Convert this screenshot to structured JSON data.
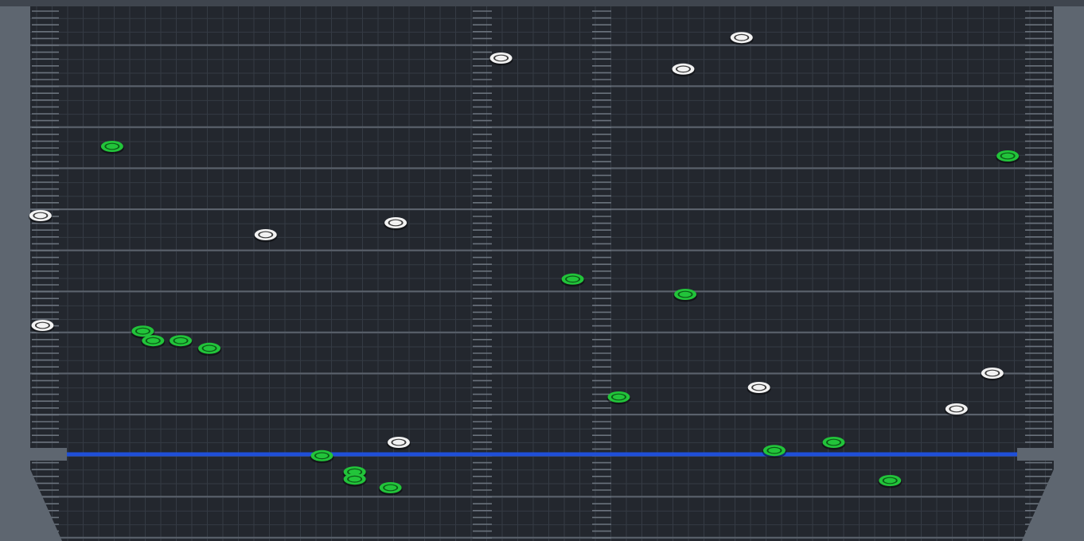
{
  "game": {
    "colors": {
      "background": "#23272e",
      "grid_line": "#353b44",
      "lane_line": "#5b626c",
      "frame": "#5e6670",
      "frame_dark": "#3f454e",
      "ruler_tick": "#6a727c",
      "judgment_line": "#1f4fd8",
      "note_green": "#22c43a",
      "note_green_dark": "#0c5a18",
      "note_white": "#f2f2f2",
      "note_white_dark": "#3a3a3a"
    },
    "icon_names": {
      "green_note": "green-note-icon",
      "white_note": "white-note-icon"
    },
    "notes": [
      {
        "type": "white",
        "lane": 0.01,
        "time": 0.5
      },
      {
        "type": "white",
        "lane": 0.012,
        "time": 0.27
      },
      {
        "type": "green",
        "lane": 0.08,
        "time": 0.645
      },
      {
        "type": "green",
        "lane": 0.11,
        "time": 0.258
      },
      {
        "type": "green",
        "lane": 0.12,
        "time": 0.238
      },
      {
        "type": "green",
        "lane": 0.147,
        "time": 0.238
      },
      {
        "type": "green",
        "lane": 0.175,
        "time": 0.222
      },
      {
        "type": "white",
        "lane": 0.23,
        "time": 0.46
      },
      {
        "type": "green",
        "lane": 0.285,
        "time": -0.003
      },
      {
        "type": "green",
        "lane": 0.317,
        "time": -0.037
      },
      {
        "type": "green",
        "lane": 0.317,
        "time": -0.052
      },
      {
        "type": "green",
        "lane": 0.352,
        "time": -0.07
      },
      {
        "type": "white",
        "lane": 0.357,
        "time": 0.485
      },
      {
        "type": "white",
        "lane": 0.36,
        "time": 0.025
      },
      {
        "type": "white",
        "lane": 0.46,
        "time": 0.83
      },
      {
        "type": "green",
        "lane": 0.53,
        "time": 0.367
      },
      {
        "type": "green",
        "lane": 0.575,
        "time": 0.12
      },
      {
        "type": "white",
        "lane": 0.638,
        "time": 0.807
      },
      {
        "type": "green",
        "lane": 0.64,
        "time": 0.335
      },
      {
        "type": "white",
        "lane": 0.695,
        "time": 0.873
      },
      {
        "type": "white",
        "lane": 0.712,
        "time": 0.14
      },
      {
        "type": "green",
        "lane": 0.727,
        "time": 0.008
      },
      {
        "type": "green",
        "lane": 0.785,
        "time": 0.025
      },
      {
        "type": "green",
        "lane": 0.84,
        "time": -0.055
      },
      {
        "type": "white",
        "lane": 0.905,
        "time": 0.095
      },
      {
        "type": "white",
        "lane": 0.94,
        "time": 0.17
      },
      {
        "type": "green",
        "lane": 0.955,
        "time": 0.625
      }
    ]
  }
}
